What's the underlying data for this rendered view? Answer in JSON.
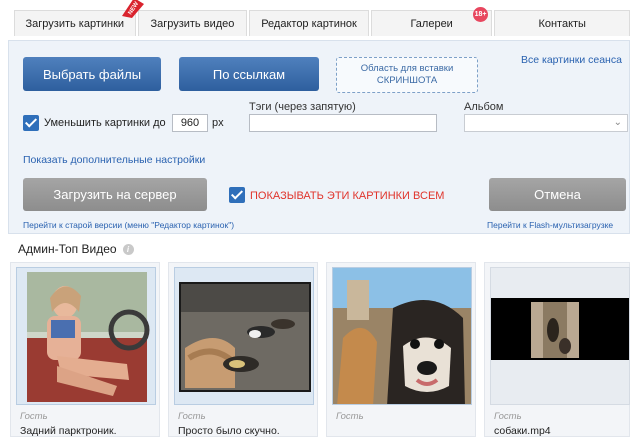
{
  "nav": {
    "tabs": [
      "Загрузить картинки",
      "Загрузить видео",
      "Редактор картинок",
      "Галереи",
      "Контакты"
    ],
    "new_badge": "NEW",
    "age_badge": "18+"
  },
  "upload": {
    "choose_files": "Выбрать файлы",
    "by_link": "По ссылкам",
    "paste_area": "Область для вставки СКРИНШОТА",
    "all_session_pics": "Все картинки сеанса",
    "reduce_label": "Уменьшить картинки до",
    "reduce_value": "960",
    "px": "px",
    "tags_label": "Тэги (через запятую)",
    "tags_value": "",
    "album_label": "Альбом",
    "album_value": "",
    "more_settings": "Показать дополнительные настройки",
    "upload_button": "Загрузить на сервер",
    "show_all_label": "ПОКАЗЫВАТЬ ЭТИ КАРТИНКИ ВСЕМ",
    "cancel_button": "Отмена",
    "old_version_link": "Перейти к старой версии (меню \"Редактор картинок\")",
    "flash_link": "Перейти к Flash-мультизагрузке",
    "reduce_checked": true,
    "show_all_checked": true
  },
  "section": {
    "title": "Админ-Топ Видео"
  },
  "videos": [
    {
      "owner": "Гость",
      "title": "Задний парктроник."
    },
    {
      "owner": "Гость",
      "title": "Просто было скучно."
    },
    {
      "owner": "Гость",
      "title": ""
    },
    {
      "owner": "Гость",
      "title": "собаки.mp4"
    }
  ],
  "colors": {
    "accent_blue": "#2e5f9e",
    "link_blue": "#2a62b0",
    "warning_red": "#e0342c",
    "badge_red": "#e8475f"
  }
}
